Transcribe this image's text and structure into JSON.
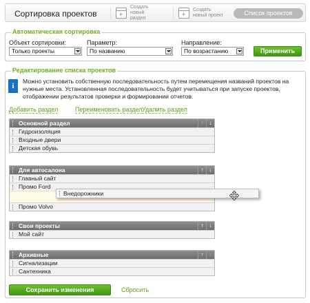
{
  "header": {
    "title": "Сортировка проектов",
    "create_section": "Создать новый раздел",
    "create_project": "Создать новый проект",
    "projects_list": "Список проектов"
  },
  "auto_sort": {
    "legend": "Автоматическая сортировка",
    "object_label": "Объект сортировки:",
    "object_value": "Только проекты",
    "param_label": "Параметр:",
    "param_value": "По названию",
    "direction_label": "Направление:",
    "direction_value": "По возрастанию",
    "apply": "Применить"
  },
  "edit": {
    "legend": "Редактирование списка проектов",
    "info": "Можно установить собственную последовательность путем перемещения названий проектов на нужные места. Установленная последовательность будет учитываться при запуске проектов, отображении результатов проверки и формировании отчетов.",
    "add_section": "Добавить раздел",
    "rename_section": "Переименовать раздел",
    "delete_section": "Удалить раздел"
  },
  "sections": [
    {
      "title": "Основной раздел",
      "items": [
        "Гидроизоляция",
        "Входные двери",
        "Детская обувь"
      ]
    },
    {
      "title": "Для автосалона",
      "items": [
        "Главный сайт",
        "Промо Ford",
        "",
        "Промо Volvo"
      ]
    },
    {
      "title": "Свои проекты",
      "items": [
        "Мой сайт"
      ]
    },
    {
      "title": "Архивные",
      "items": [
        "Сигнализации",
        "Сантехника"
      ]
    }
  ],
  "dragging_item": "Внедорожники",
  "footer": {
    "save": "Сохранить изменения",
    "reset": "Сбросить"
  },
  "colors": {
    "accent_green": "#5aa319",
    "button_green": "#4fa81c",
    "info_blue": "#1672c5",
    "section_header": "#7d7d7d"
  },
  "icons": [
    "new-section-icon",
    "new-project-icon",
    "info-icon",
    "arrow-up-icon",
    "arrow-down-icon",
    "drag-handle-icon",
    "move-cursor-icon",
    "dropdown-arrow-icon"
  ]
}
